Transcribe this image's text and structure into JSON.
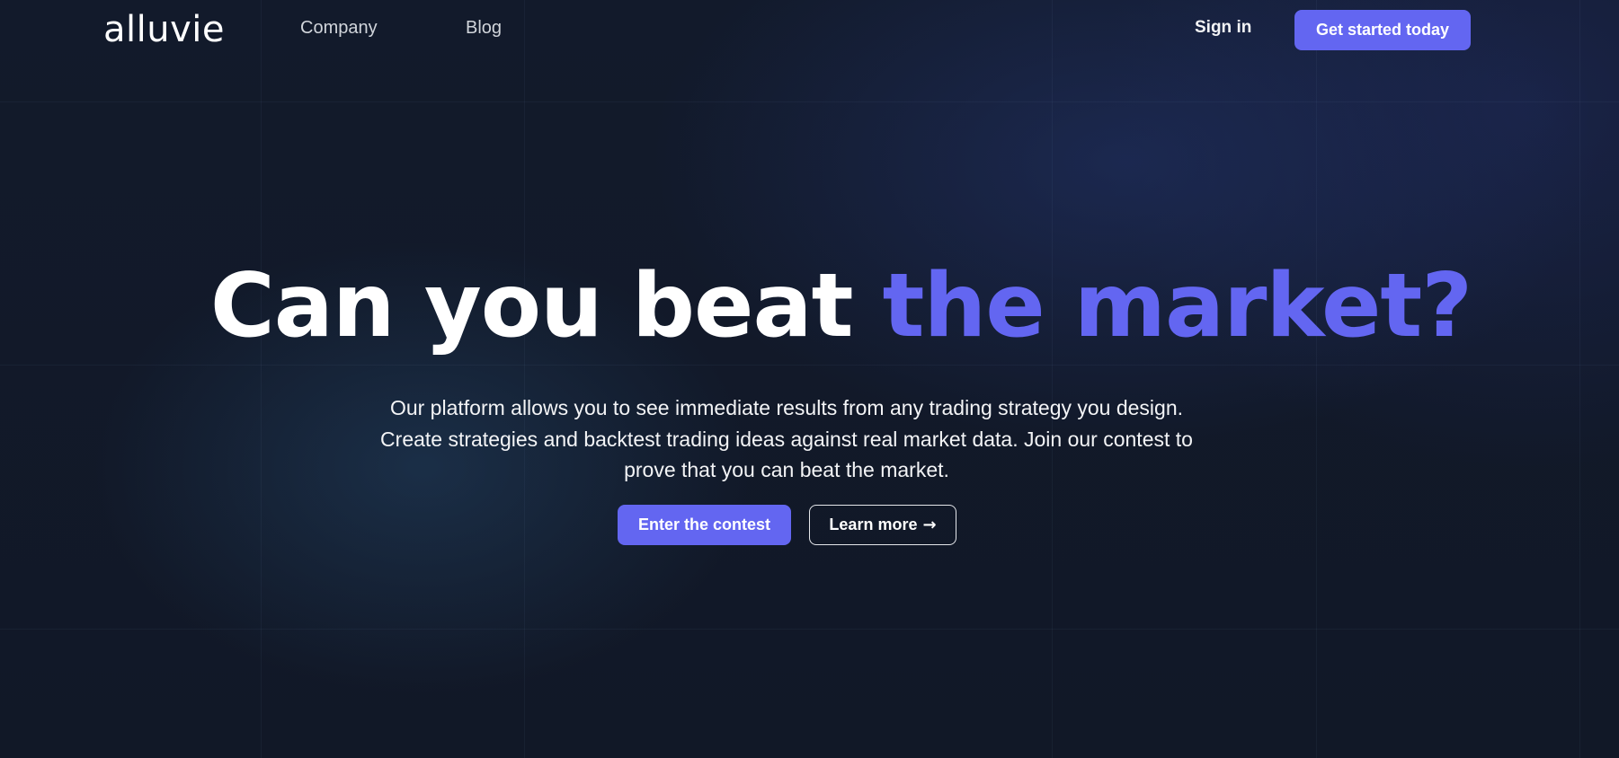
{
  "brand": {
    "logo_text": "alluvie",
    "accent_color": "#6366f1",
    "background_color": "#111827"
  },
  "nav": {
    "links": [
      {
        "label": "Company"
      },
      {
        "label": "Blog"
      }
    ],
    "sign_in_label": "Sign in",
    "cta_label": "Get started today"
  },
  "hero": {
    "title_plain": "Can you beat ",
    "title_accent": "the market?",
    "subtitle_lines": [
      "Our platform allows you to see immediate results from any trading strategy you design.",
      "Create strategies and backtest trading ideas against real market data. Join our contest to",
      "prove that you can beat the market."
    ],
    "primary_button_label": "Enter the contest",
    "secondary_button_label": "Learn more",
    "secondary_button_icon": "arrow-right-icon"
  }
}
